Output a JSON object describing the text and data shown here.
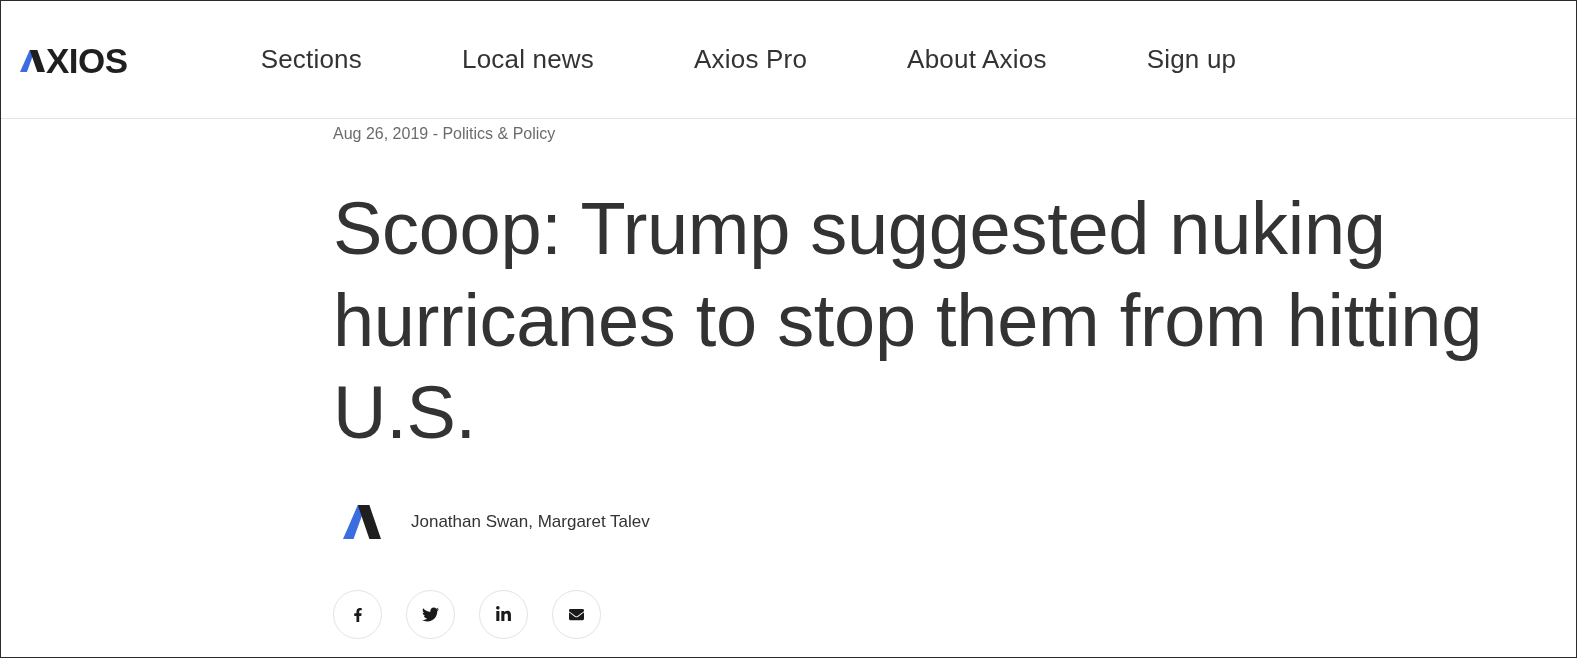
{
  "header": {
    "logo": {
      "text": "XIOS"
    },
    "nav": [
      {
        "label": "Sections"
      },
      {
        "label": "Local news"
      },
      {
        "label": "Axios Pro"
      },
      {
        "label": "About Axios"
      },
      {
        "label": "Sign up"
      }
    ]
  },
  "article": {
    "dateline": "Aug 26, 2019 - Politics & Policy",
    "headline": "Scoop: Trump suggested nuking hurricanes to stop them from hitting U.S.",
    "byline": {
      "authors": "Jonathan Swan, Margaret Talev"
    },
    "share_buttons": [
      {
        "kind": "facebook"
      },
      {
        "kind": "twitter"
      },
      {
        "kind": "linkedin"
      },
      {
        "kind": "email"
      }
    ]
  }
}
